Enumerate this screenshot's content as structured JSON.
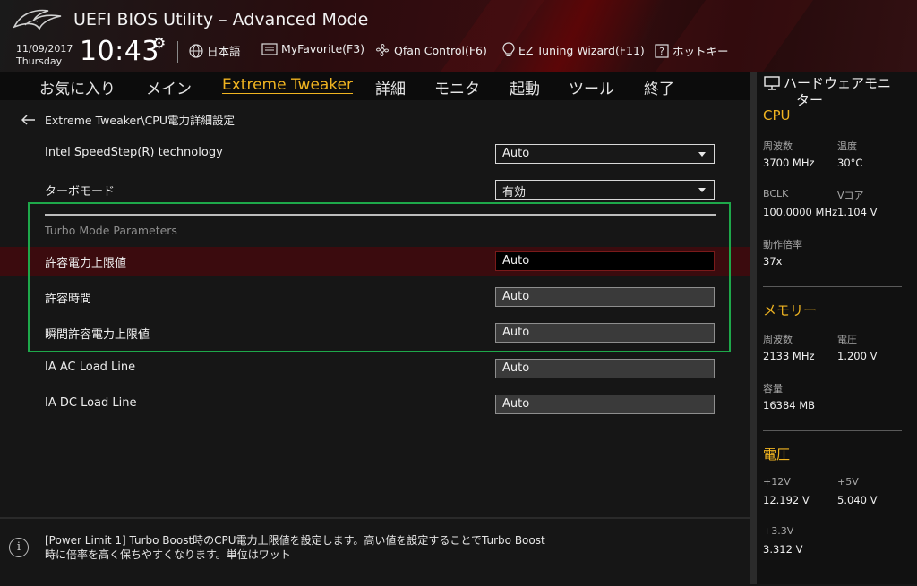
{
  "header": {
    "app_title": "UEFI BIOS Utility – Advanced Mode",
    "date": "11/09/2017",
    "weekday": "Thursday",
    "time": "10:43",
    "tools": {
      "language": "日本語",
      "my_favorite": "MyFavorite(F3)",
      "qfan": "Qfan Control(F6)",
      "ez_tuning": "EZ Tuning Wizard(F11)",
      "hotkeys": "ホットキー"
    }
  },
  "nav": {
    "tabs": [
      {
        "label": "お気に入り"
      },
      {
        "label": "メイン"
      },
      {
        "label": "Extreme Tweaker"
      },
      {
        "label": "詳細"
      },
      {
        "label": "モニタ"
      },
      {
        "label": "起動"
      },
      {
        "label": "ツール"
      },
      {
        "label": "終了"
      }
    ],
    "active_tab": "Extreme Tweaker",
    "accent_color": "#f0b421"
  },
  "main": {
    "breadcrumb": "Extreme Tweaker\\CPU電力詳細設定",
    "rows": [
      {
        "label": "Intel SpeedStep(R) technology",
        "value": "Auto",
        "control": "dropdown"
      },
      {
        "label": "ターボモード",
        "value": "有効",
        "control": "dropdown"
      }
    ],
    "section_title": "Turbo Mode Parameters",
    "params": [
      {
        "label": "許容電力上限値",
        "value": "Auto",
        "selected": true
      },
      {
        "label": "許容時間",
        "value": "Auto"
      },
      {
        "label": "瞬間許容電力上限値",
        "value": "Auto"
      },
      {
        "label": "IA AC Load Line",
        "value": "Auto"
      },
      {
        "label": "IA DC Load Line",
        "value": "Auto"
      }
    ],
    "highlight_color": "#1ea84a"
  },
  "help": {
    "icon": "info-icon",
    "text": "[Power Limit 1] Turbo Boost時のCPU電力上限値を設定します。高い値を設定することでTurbo Boost時に倍率を高く保ちやすくなります。単位はワット"
  },
  "hw_monitor": {
    "title_line1": "ハードウェアモニ",
    "title_line2": "ター",
    "cpu": {
      "heading": "CPU",
      "freq_label": "周波数",
      "freq_value": "3700 MHz",
      "temp_label": "温度",
      "temp_value": "30°C",
      "bclk_label": "BCLK",
      "bclk_value": "100.0000 MHz",
      "vcore_label": "Vコア",
      "vcore_value": "1.104 V",
      "ratio_label": "動作倍率",
      "ratio_value": "37x"
    },
    "memory": {
      "heading": "メモリー",
      "freq_label": "周波数",
      "freq_value": "2133 MHz",
      "volt_label": "電圧",
      "volt_value": "1.200 V",
      "cap_label": "容量",
      "cap_value": "16384 MB"
    },
    "voltage": {
      "heading": "電圧",
      "v12_label": "+12V",
      "v12_value": "12.192 V",
      "v5_label": "+5V",
      "v5_value": "5.040 V",
      "v33_label": "+3.3V",
      "v33_value": "3.312 V"
    }
  }
}
